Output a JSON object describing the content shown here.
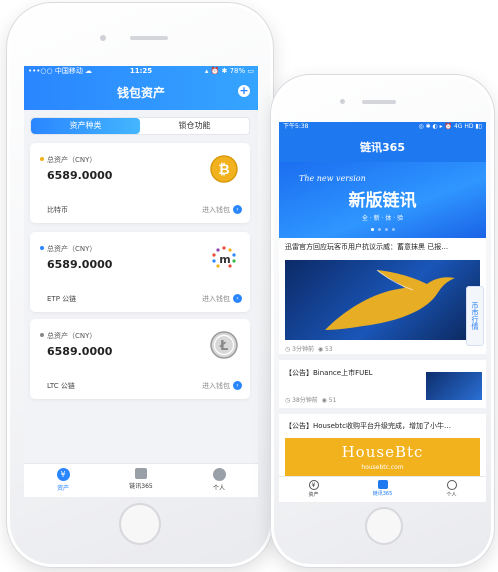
{
  "left_phone": {
    "status_bar": {
      "carrier": "•••○○ 中国移动 ☁",
      "time": "11:25",
      "battery": "▴ ⏰ ✱ 78% ▭"
    },
    "title": "钱包资产",
    "segments": [
      {
        "label": "资产种类",
        "active": true
      },
      {
        "label": "锁仓功能",
        "active": false
      }
    ],
    "cards": [
      {
        "label": "总资产（CNY）",
        "amount": "6589.0000",
        "name": "比特币",
        "enter": "进入钱包",
        "dot_color": "#f2b21d",
        "coin": "bitcoin-icon"
      },
      {
        "label": "总资产（CNY）",
        "amount": "6589.0000",
        "name": "ETP 公链",
        "enter": "进入钱包",
        "dot_color": "#2a86ff",
        "coin": "metaverse-icon"
      },
      {
        "label": "总资产（CNY）",
        "amount": "6589.0000",
        "name": "LTC 公链",
        "enter": "进入钱包",
        "dot_color": "#888888",
        "coin": "litecoin-icon"
      }
    ],
    "tabs": [
      {
        "label": "资产",
        "active": true
      },
      {
        "label": "链讯365",
        "active": false
      },
      {
        "label": "个人",
        "active": false
      }
    ]
  },
  "right_phone": {
    "status_bar": {
      "time": "下午5:38",
      "icons": "◎ ✱ ◐ ▸ ⏰ 4G HD ▮▯"
    },
    "title": "链讯365",
    "banner": {
      "english": "The new version",
      "headline": "新版链讯",
      "sub": "全 · 新 · 体 · 验"
    },
    "headline": "迅雷官方回应玩客币用户抗议示威：蓄意抹黑 已报…",
    "news1_meta": {
      "time": "3分钟前",
      "views": "53"
    },
    "side_tab": "币市行情",
    "news2": {
      "title": "【公告】Binance上市FUEL",
      "time": "38分钟前",
      "views": "51"
    },
    "news3": {
      "title": "【公告】Housebtc收购平台升级完成，增加了小牛…"
    },
    "ad": {
      "brand": "HouseBtc",
      "url": "housebtc.com"
    },
    "tabs": [
      {
        "label": "资产",
        "active": false
      },
      {
        "label": "链讯365",
        "active": true
      },
      {
        "label": "个人",
        "active": false
      }
    ]
  },
  "colors": {
    "accent": "#2a86ff",
    "bitcoin": "#f2b21d"
  }
}
